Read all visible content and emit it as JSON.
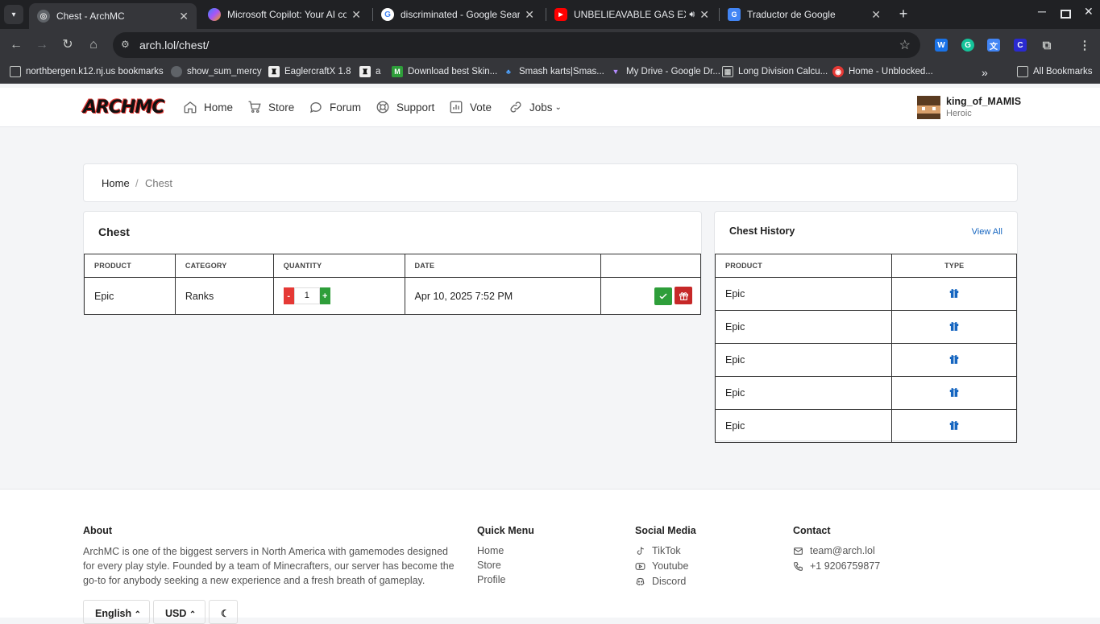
{
  "browser": {
    "tabs": [
      {
        "title": "Chest - ArchMC",
        "active": true
      },
      {
        "title": "Microsoft Copilot: Your AI comp",
        "active": false
      },
      {
        "title": "discriminated - Google Search",
        "active": false
      },
      {
        "title": "UNBELIEAVABLE GAS EXP",
        "active": false
      },
      {
        "title": "Traductor de Google",
        "active": false
      }
    ],
    "url": "arch.lol/chest/",
    "bookmarks": [
      "northbergen.k12.nj.us bookmarks",
      "show_sum_mercy",
      "EaglercraftX 1.8",
      "a",
      "Download best Skin...",
      "Smash karts|Smas...",
      "My Drive - Google Dr...",
      "Long Division Calcu...",
      "Home - Unblocked..."
    ],
    "all_bookmarks": "All Bookmarks"
  },
  "site": {
    "logo": "ARCHMC",
    "nav": [
      "Home",
      "Store",
      "Forum",
      "Support",
      "Vote",
      "Jobs"
    ],
    "user": {
      "name": "king_of_MAMIS",
      "rank": "Heroic"
    }
  },
  "breadcrumb": {
    "home": "Home",
    "separator": "/",
    "current": "Chest"
  },
  "chest": {
    "title": "Chest",
    "headers": [
      "PRODUCT",
      "CATEGORY",
      "QUANTITY",
      "DATE",
      ""
    ],
    "row": {
      "product": "Epic",
      "category": "Ranks",
      "minus": "-",
      "quantity": "1",
      "plus": "+",
      "date": "Apr 10, 2025 7:52 PM"
    }
  },
  "history": {
    "title": "Chest History",
    "view_all": "View All",
    "headers": [
      "PRODUCT",
      "TYPE"
    ],
    "rows": [
      "Epic",
      "Epic",
      "Epic",
      "Epic",
      "Epic"
    ]
  },
  "footer": {
    "about_title": "About",
    "about_text": "ArchMC is one of the biggest servers in North America with gamemodes designed for every play style. Founded by a team of Minecrafters, our server has become the go-to for anybody seeking a new experience and a fresh breath of gameplay.",
    "quick_title": "Quick Menu",
    "quick": [
      "Home",
      "Store",
      "Profile"
    ],
    "social_title": "Social Media",
    "social": [
      "TikTok",
      "Youtube",
      "Discord"
    ],
    "contact_title": "Contact",
    "email": "team@arch.lol",
    "phone": "+1 9206759877",
    "language": "English",
    "currency": "USD"
  },
  "colors": {
    "minus": "#e53935",
    "plus": "#2e9e3a",
    "claim": "#2e9e3a",
    "gift": "#c62828",
    "link": "#1565c0"
  }
}
